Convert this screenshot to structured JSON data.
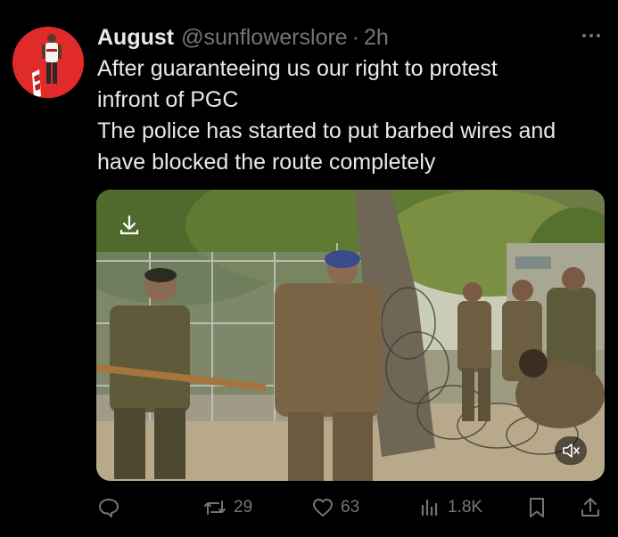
{
  "tweet": {
    "author": {
      "display_name": "August",
      "handle": "@sunflowerslore",
      "separator": "·",
      "time": "2h",
      "avatar_icon": "person-avatar-icon"
    },
    "text_lines": [
      "After guaranteeing us our right to protest",
      "infront of PGC",
      "The police has started to put barbed wires and",
      "have blocked the route completely"
    ],
    "media": {
      "type": "video",
      "download_icon": "download-icon",
      "mute_icon": "speaker-muted-icon"
    },
    "actions": {
      "reply": {
        "icon": "reply-icon",
        "count": ""
      },
      "retweet": {
        "icon": "retweet-icon",
        "count": "29"
      },
      "like": {
        "icon": "heart-icon",
        "count": "63"
      },
      "views": {
        "icon": "views-icon",
        "count": "1.8K"
      },
      "bookmark": {
        "icon": "bookmark-icon"
      },
      "share": {
        "icon": "share-icon"
      }
    }
  },
  "colors": {
    "background": "#000000",
    "primary_text": "#e7e9ea",
    "secondary_text": "#71767b",
    "avatar_bg": "#e12a2a"
  }
}
